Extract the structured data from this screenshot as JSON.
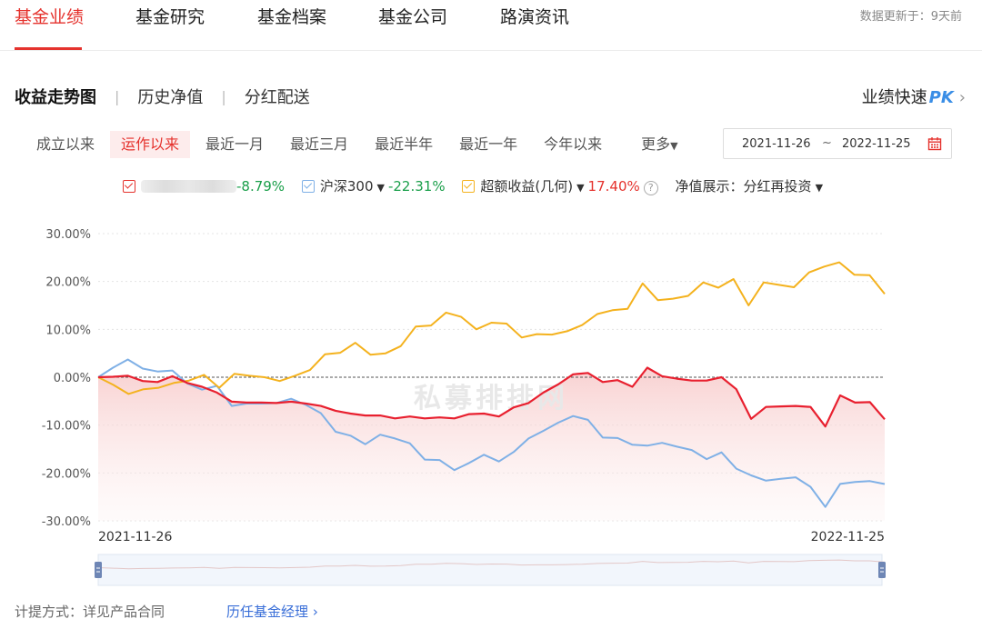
{
  "topnav": {
    "tabs": [
      "基金业绩",
      "基金研究",
      "基金档案",
      "基金公司",
      "路演资讯"
    ],
    "updated": "数据更新于：9天前"
  },
  "subnav": {
    "items": [
      "收益走势图",
      "历史净值",
      "分红配送"
    ],
    "pk_label": "业绩快速",
    "pk_mark": "PK",
    "pk_chevron": "›"
  },
  "ranges": {
    "items": [
      "成立以来",
      "运作以来",
      "最近一月",
      "最近三月",
      "最近半年",
      "最近一年",
      "今年以来"
    ],
    "more": "更多",
    "start": "2021-11-26",
    "tilde": "~",
    "end": "2022-11-25"
  },
  "legend": {
    "fund_return": "-8.79%",
    "hs300_name": "沪深300",
    "hs300_return": "-22.31%",
    "excess_name": "超额收益(几何)",
    "excess_return": "17.40%",
    "help": "?",
    "nav_label": "净值展示：",
    "nav_mode": "分红再投资"
  },
  "watermark": "私募排排网",
  "footer": {
    "fee": "计提方式：详见产品合同",
    "managers": "历任基金经理",
    "managers_chevron": "›"
  },
  "colors": {
    "fund": "#e8202f",
    "hs300": "#7fb0e6",
    "excess": "#f4b21e",
    "accent": "#e5322d"
  },
  "chart_data": {
    "type": "line",
    "ylim": [
      -30,
      30
    ],
    "yticks": [
      "30.00%",
      "20.00%",
      "10.00%",
      "0.00%",
      "-10.00%",
      "-20.00%",
      "-30.00%"
    ],
    "x_start": "2021-11-26",
    "x_end": "2022-11-25",
    "grid": true,
    "legend_position": "top",
    "series": [
      {
        "name": "",
        "color": "#e8202f",
        "area": true,
        "values": [
          0,
          0.1,
          0.3,
          -0.8,
          -1,
          0.2,
          -1.2,
          -2,
          -3.2,
          -5.1,
          -5.3,
          -5.3,
          -5.4,
          -5.1,
          -5.5,
          -6,
          -7,
          -7.6,
          -8,
          -8,
          -8.6,
          -8.2,
          -8.6,
          -8.4,
          -8.6,
          -7.7,
          -7.6,
          -8.2,
          -6.3,
          -5.4,
          -3.2,
          -1.5,
          0.6,
          0.9,
          -1,
          -0.6,
          -2,
          2,
          0.2,
          -0.3,
          -0.7,
          -0.7,
          0,
          -2.5,
          -8.7,
          -6.2,
          -6.1,
          -6,
          -6.2,
          -10.3,
          -3.8,
          -5.3,
          -5.2,
          -8.79
        ]
      },
      {
        "name": "沪深300",
        "color": "#7fb0e6",
        "area": false,
        "values": [
          0,
          2,
          3.7,
          1.8,
          1.2,
          1.4,
          -1.3,
          -2.6,
          -1.8,
          -6,
          -5.5,
          -5.5,
          -5.4,
          -4.5,
          -5.8,
          -7.5,
          -11.4,
          -12.2,
          -14,
          -12,
          -12.8,
          -13.8,
          -17.2,
          -17.3,
          -19.4,
          -17.9,
          -16.2,
          -17.6,
          -15.6,
          -12.8,
          -11.2,
          -9.5,
          -8.1,
          -8.9,
          -12.6,
          -12.7,
          -14.1,
          -14.3,
          -13.7,
          -14.5,
          -15.2,
          -17.1,
          -15.7,
          -19.1,
          -20.5,
          -21.6,
          -21.2,
          -20.9,
          -22.9,
          -27.1,
          -22.3,
          -21.9,
          -21.7,
          -22.31
        ]
      },
      {
        "name": "超额收益(几何)",
        "color": "#f4b21e",
        "area": false,
        "values": [
          0,
          -1.6,
          -3.5,
          -2.5,
          -2.2,
          -1.2,
          -0.7,
          0.5,
          -2.2,
          0.7,
          0.3,
          0,
          -0.8,
          0.3,
          1.5,
          4.8,
          5.1,
          7.2,
          4.7,
          5,
          6.5,
          10.6,
          10.8,
          13.5,
          12.6,
          10,
          11.4,
          11.2,
          8.3,
          9,
          8.9,
          9.6,
          10.9,
          13.2,
          14,
          14.3,
          19.6,
          16.1,
          16.4,
          17,
          19.8,
          18.7,
          20.5,
          15,
          19.8,
          19.3,
          18.8,
          21.9,
          23.1,
          24,
          21.4,
          21.3,
          17.4
        ]
      }
    ]
  }
}
